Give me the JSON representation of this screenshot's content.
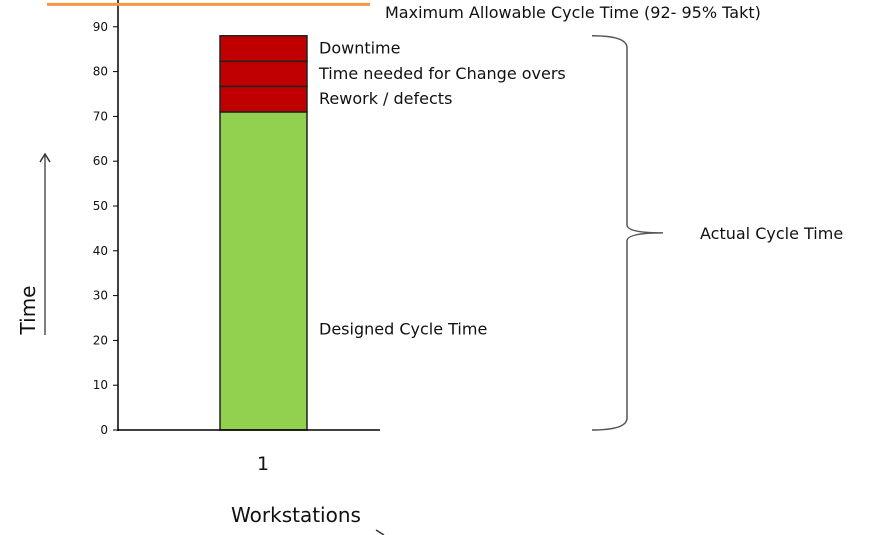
{
  "chart_data": {
    "type": "bar",
    "stacked": true,
    "categories": [
      "1"
    ],
    "xlabel": "Workstations",
    "ylabel": "Time",
    "ylim": [
      0,
      95
    ],
    "yticks": [
      0,
      10,
      20,
      30,
      40,
      50,
      60,
      70,
      80,
      90
    ],
    "grid": false,
    "series": [
      {
        "name": "Designed Cycle Time",
        "values": [
          71
        ],
        "color": "#92d050"
      },
      {
        "name": "Rework / defects",
        "values": [
          5.7
        ],
        "color": "#c00000"
      },
      {
        "name": "Time needed for Change overs",
        "values": [
          5.6
        ],
        "color": "#c00000"
      },
      {
        "name": "Downtime",
        "values": [
          5.7
        ],
        "color": "#c00000"
      }
    ],
    "reference_line": {
      "label": "Maximum Allowable Cycle Time (92- 95% Takt)",
      "value": 95,
      "color": "#f79646"
    },
    "brace_annotation": {
      "label": "Actual Cycle Time",
      "from": 0,
      "to": 88
    }
  }
}
